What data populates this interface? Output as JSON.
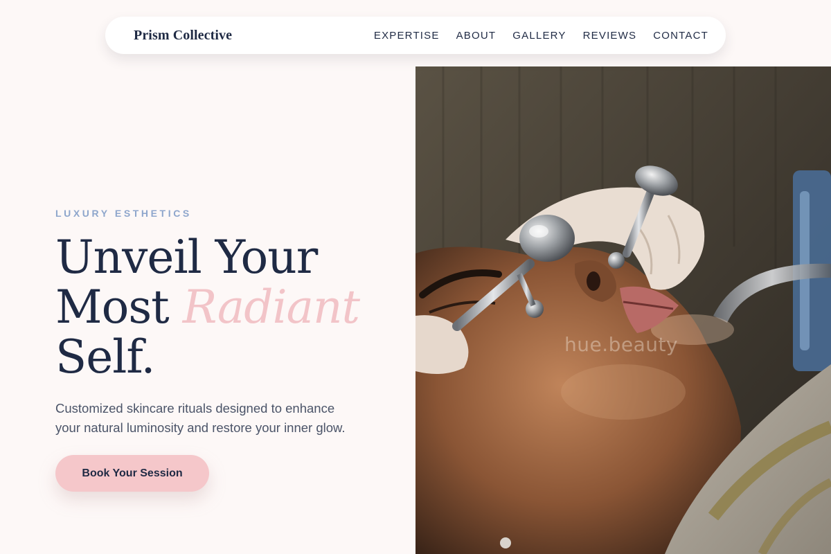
{
  "navbar": {
    "brand": "Prism Collective",
    "links": [
      {
        "label": "EXPERTISE"
      },
      {
        "label": "ABOUT"
      },
      {
        "label": "GALLERY"
      },
      {
        "label": "REVIEWS"
      },
      {
        "label": "CONTACT"
      }
    ]
  },
  "hero": {
    "eyebrow": "LUXURY ESTHETICS",
    "headline": {
      "line1": "Unveil Your",
      "line2_plain": "Most ",
      "line2_accent": "Radiant",
      "line3": "Self."
    },
    "subtext": "Customized skincare rituals designed to enhance your natural luminosity and restore your inner glow.",
    "cta_label": "Book Your Session",
    "image": {
      "subject": "Facial treatment with chilled metal globe rollers",
      "watermark": "hue.beauty"
    }
  },
  "colors": {
    "background": "#fdf8f7",
    "navy": "#1f2a44",
    "accent_pink": "#f2c4c8",
    "button_pink": "#f5c7ca",
    "eyebrow_blue": "#8ea6cc"
  }
}
